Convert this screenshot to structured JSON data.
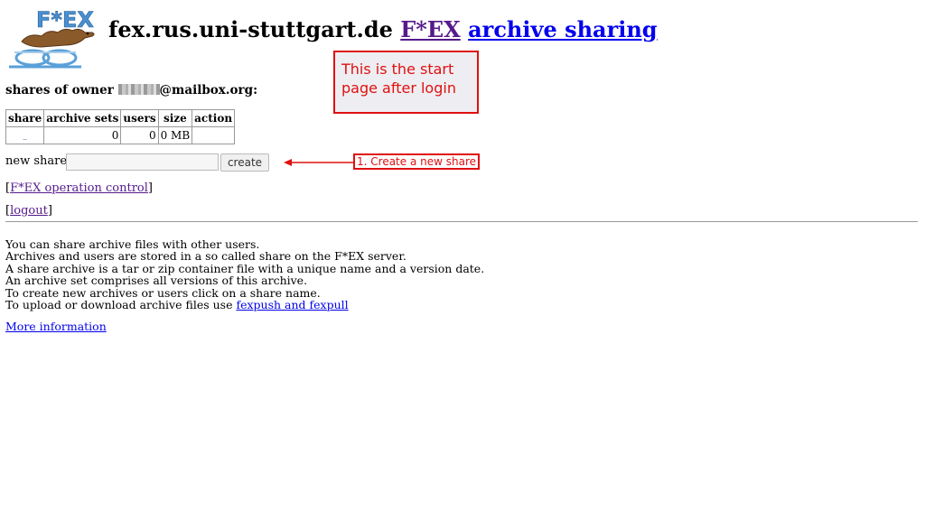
{
  "header": {
    "host": "fex.rus.uni-stuttgart.de",
    "fex_link": "F*EX",
    "archive_link": "archive sharing",
    "logo_text": "F*EX"
  },
  "note": "This is the start page after login",
  "owner": {
    "prefix": "shares of owner",
    "suffix": "@mailbox.org:"
  },
  "table": {
    "headers": [
      "share",
      "archive sets",
      "users",
      "size",
      "action"
    ],
    "rows": [
      {
        "share": "_",
        "archive_sets": "0",
        "users": "0",
        "size": "0 MB",
        "action": ""
      }
    ]
  },
  "new_share": {
    "label": "new share:",
    "value": "",
    "button": "create"
  },
  "annotation_step": "1. Create a new share",
  "links": {
    "operation_control": "F*EX operation control",
    "logout": "logout",
    "bracket_open": "[",
    "bracket_close": "]"
  },
  "info": {
    "lines": [
      "You can share archive files with other users.",
      "Archives and users are stored in a so called share on the F*EX server.",
      "A share archive is a tar or zip container file with a unique name and a version date.",
      "An archive set comprises all versions of this archive.",
      "To create new archives or users click on a share name."
    ],
    "last_prefix": "To upload or download archive files use ",
    "last_link": "fexpush and fexpull"
  },
  "more_info": "More information",
  "colors": {
    "annotation": "#e01010",
    "link": "#0000ee",
    "visited": "#551a8b"
  }
}
